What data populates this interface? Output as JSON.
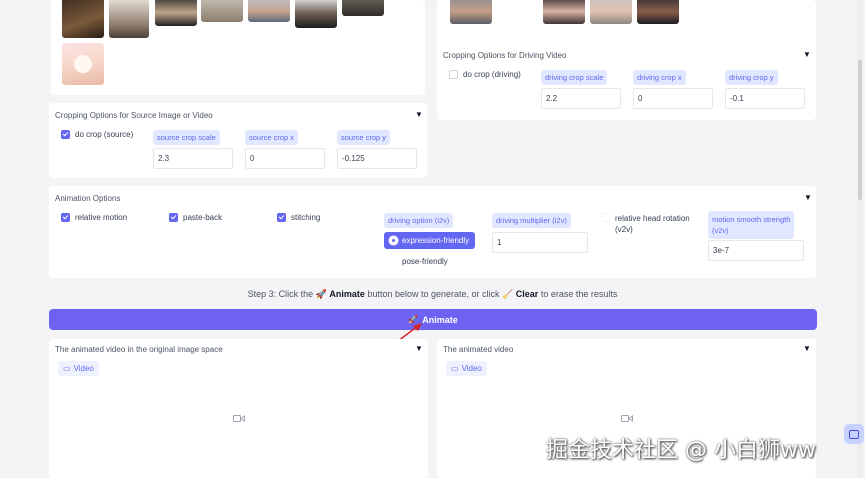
{
  "source_panel": {
    "crop_title": "Cropping Options for Source Image or Video",
    "do_crop_label": "do crop (source)",
    "scale_label": "source crop scale",
    "scale_value": "2.3",
    "x_label": "source crop x",
    "x_value": "0",
    "y_label": "source crop y",
    "y_value": "-0.125"
  },
  "driving_panel": {
    "crop_title": "Cropping Options for Driving Video",
    "do_crop_label": "do crop (driving)",
    "scale_label": "driving crop scale",
    "scale_value": "2.2",
    "x_label": "driving crop x",
    "x_value": "0",
    "y_label": "driving crop y",
    "y_value": "-0.1"
  },
  "animation": {
    "title": "Animation Options",
    "relative_motion": "relative motion",
    "paste_back": "paste-back",
    "stitching": "stitching",
    "driving_option_label": "driving option (i2v)",
    "option_expression": "expression-friendly",
    "option_pose": "pose-friendly",
    "multiplier_label": "driving multiplier (i2v)",
    "multiplier_value": "1",
    "head_rotation_label_1": "relative head rotation",
    "head_rotation_label_2": "(v2v)",
    "smooth_label_1": "motion smooth strength",
    "smooth_label_2": "(v2v)",
    "smooth_value": "3e-7"
  },
  "step3": {
    "prefix": "Step 3: Click the",
    "animate_word": "Animate",
    "middle": "button below to generate, or click",
    "clear_word": "Clear",
    "suffix": "to erase the results"
  },
  "animate_button": "Animate",
  "output_left": {
    "title": "The animated video in the original image space",
    "badge": "Video"
  },
  "output_right": {
    "title": "The animated video",
    "badge": "Video"
  },
  "watermark": "掘金技术社区 @ 小白狮ww",
  "colors": {
    "accent": "#6366f1",
    "accent_light": "#e0e7ff"
  },
  "icons": [
    "rocket-icon",
    "broom-icon",
    "video-icon",
    "camera-icon",
    "caret-down-icon",
    "check-icon",
    "chat-icon"
  ]
}
